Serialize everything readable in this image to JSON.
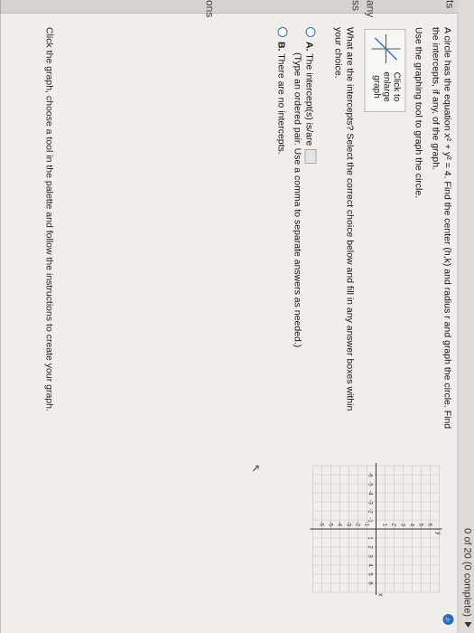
{
  "progress": {
    "label": "0 of 20 (0 complete)"
  },
  "sidebar": {
    "labels": [
      "ts",
      "any",
      "ss",
      "ons"
    ]
  },
  "question": {
    "line1": "A circle has the equation x² + y² = 4. Find the center (h,k) and radius r and graph the circle. Find",
    "line2": "the intercepts, if any, of the graph.",
    "instruction": "Use the graphing tool to graph the circle.",
    "thumb_label": "Click to enlarge graph",
    "prompt": "What are the intercepts? Select the correct choice below and fill in any answer boxes within your choice."
  },
  "options": [
    {
      "letter": "A.",
      "text": "The intercept(s) is/are",
      "hint": "(Type an ordered pair. Use a comma to separate answers as needed.)"
    },
    {
      "letter": "B.",
      "text": "There are no intercepts."
    }
  ],
  "bottom_instruction": "Click the graph, choose a tool in the palette and follow the instructions to create your graph.",
  "graph": {
    "x_ticks": [
      "-6",
      "-5",
      "-4",
      "-3",
      "-2",
      "-1",
      "1",
      "2",
      "3",
      "4",
      "5",
      "6"
    ],
    "y_ticks": [
      "6",
      "5",
      "4",
      "3",
      "2",
      "1",
      "-1",
      "-2",
      "-3",
      "-4",
      "-5",
      "-6"
    ],
    "x_label": "x",
    "y_label": "y"
  },
  "zoom_icon": "magnifier-icon",
  "cursor_icon": "pointer-cursor-icon",
  "colors": {
    "accent": "#2f6fb7",
    "grid": "#c7c7c7"
  }
}
